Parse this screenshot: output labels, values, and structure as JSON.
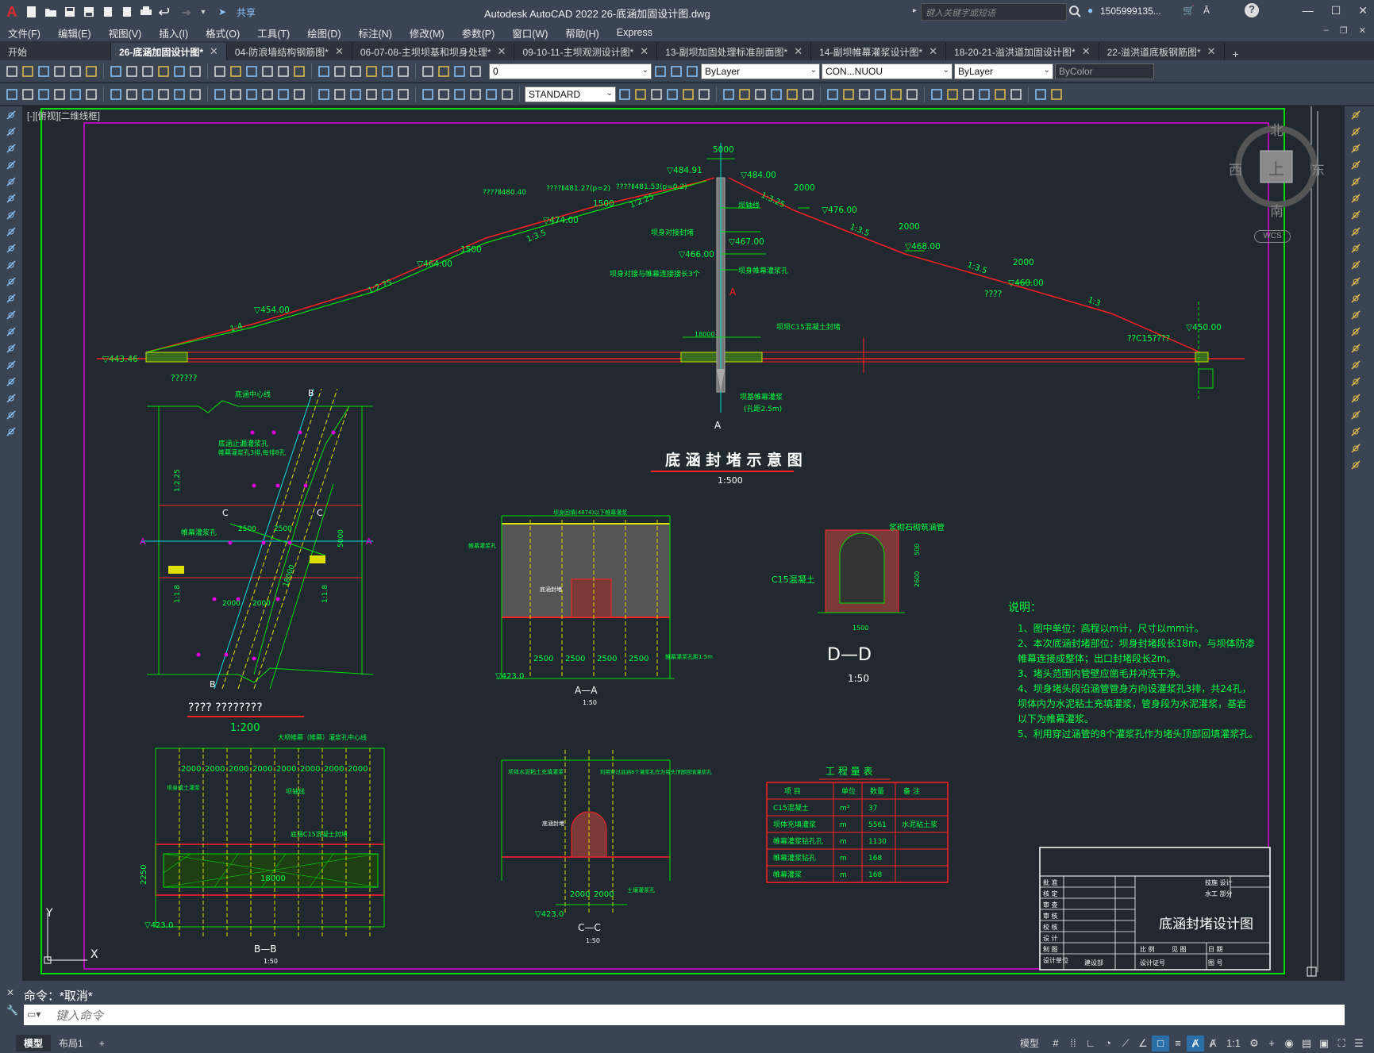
{
  "app": {
    "logo": "A",
    "window_title": "Autodesk AutoCAD 2022    26-底涵加固设计图.dwg",
    "share_label": "共享",
    "search_placeholder": "键入关键字或短语",
    "user_name": "1505999135...",
    "help_label": "?"
  },
  "menus": [
    "文件(F)",
    "编辑(E)",
    "视图(V)",
    "插入(I)",
    "格式(O)",
    "工具(T)",
    "绘图(D)",
    "标注(N)",
    "修改(M)",
    "参数(P)",
    "窗口(W)",
    "帮助(H)",
    "Express"
  ],
  "tabs": [
    {
      "label": "开始",
      "active": false,
      "closable": false
    },
    {
      "label": "26-底涵加固设计图*",
      "active": true,
      "closable": true
    },
    {
      "label": "04-防浪墙结构钢筋图*",
      "active": false,
      "closable": true
    },
    {
      "label": "06-07-08-主坝坝基和坝身处理*",
      "active": false,
      "closable": true
    },
    {
      "label": "09-10-11-主坝观测设计图*",
      "active": false,
      "closable": true
    },
    {
      "label": "13-副坝加固处理标准剖面图*",
      "active": false,
      "closable": true
    },
    {
      "label": "14-副坝帷幕灌浆设计图*",
      "active": false,
      "closable": true
    },
    {
      "label": "18-20-21-溢洪道加固设计图*",
      "active": false,
      "closable": true
    },
    {
      "label": "22-溢洪道底板钢筋图*",
      "active": false,
      "closable": true
    }
  ],
  "toolbar": {
    "layer_value": "0",
    "color_value": "ByLayer",
    "linetype_value": "CON...NUOU",
    "lineweight_value": "ByLayer",
    "plotstyle_value": "ByColor",
    "textstyle_value": "STANDARD"
  },
  "viewport_label": "[-][俯视][二维线框]",
  "viewcube": {
    "north": "北",
    "south": "南",
    "east": "东",
    "west": "西",
    "top": "上",
    "wcs": "WCS"
  },
  "drawing": {
    "main_title": "底 涵 封 堵 示 意 图",
    "main_scale": "1:500",
    "elevations": [
      "▽484.91",
      "▽484.00",
      "▽476.00",
      "▽474.00",
      "▽468.00",
      "▽467.00",
      "▽466.00",
      "▽464.00",
      "▽460.00",
      "▽454.00",
      "▽450.00",
      "▽443.46",
      "▽423.0"
    ],
    "dims_top": [
      "5000",
      "2000",
      "1500",
      "1500",
      "2000",
      "2000",
      "2000",
      "18000",
      "2250"
    ],
    "slopes": [
      "1:2.25",
      "1:2.75",
      "1:3.5",
      "1:4",
      "1:3.25",
      "1:3.5",
      "1:3.5",
      "1:3"
    ],
    "annotations_top": [
      "????Ⅱ480.40",
      "????Ⅱ481.27(p=2)",
      "????Ⅱ481.53(p=0.2)",
      "??????",
      "????",
      "????",
      "??C15????",
      "坝轴线",
      "坝身对接封堵",
      "坝身对接与帷幕连接接长3个",
      "坝身帷幕灌浆孔",
      "坝坝C15混凝土封堵",
      "坝基帷幕灌浆",
      "(孔距2.5m)"
    ],
    "plan_labels": [
      "底涵中心线",
      "底涵止漏灌浆孔",
      "帷幕灌浆孔",
      "帷幕灌浆孔3排,每排8孔"
    ],
    "plan_title": "????    ????????",
    "plan_scale": "1:200",
    "plan_dims": [
      "2500",
      "2500",
      "2000",
      "2000",
      "18000",
      "5000",
      "1:2.25",
      "1:1.8",
      "1:1.8"
    ],
    "section_aa": {
      "title": "A—A",
      "scale": "1:50",
      "dims": [
        "2500",
        "2500",
        "2500",
        "2500"
      ],
      "elev": "▽423.0",
      "labels": [
        "坝身回填(4874)以下帷幕灌浆",
        "帷幕灌浆孔",
        "底涵封堵",
        "帷幕灌浆孔距1.5m"
      ]
    },
    "section_dd": {
      "title": "D—D",
      "scale": "1:50",
      "labels": [
        "C15混凝土",
        "浆砌石砌筑涵管"
      ],
      "dims": [
        "1500",
        "2600",
        "500"
      ]
    },
    "section_bb": {
      "title": "B—B",
      "scale": "1:50",
      "dims": [
        "2000",
        "2000",
        "2000",
        "2000",
        "2000",
        "2000",
        "2000",
        "2000",
        "18000",
        "2250"
      ],
      "labels": [
        "大坝帷幕（帷幕）灌浆孔中心线",
        "底涵C15混凝土封堵",
        "坝身填土灌浆",
        "坝轴线"
      ],
      "elev": "▽423.0"
    },
    "section_cc": {
      "title": "C—C",
      "scale": "1:50",
      "dims": [
        "2000",
        "2000"
      ],
      "elev": "▽423.0",
      "labels": [
        "坝体水泥粘土充填灌浆",
        "利用穿过底涵8个灌浆孔作为堵头顶部回填灌浆孔",
        "底涵封堵",
        "土壤灌浆孔"
      ]
    },
    "notes_title": "说明：",
    "notes": [
      "1、图中单位：高程以m计，尺寸以mm计。",
      "2、本次底涵封堵部位：坝身封堵段长18m，与坝体防渗",
      "   帷幕连接成整体；出口封堵段长2m。",
      "3、堵头范围内管壁应凿毛并冲洗干净。",
      "4、坝身堵头段沿涵管管身方向设灌浆孔3排，共24孔，",
      "   坝体内为水泥粘土充填灌浆，管身段为水泥灌浆，基岩",
      "   以下为帷幕灌浆。",
      "5、利用穿过涵管的8个灌浆孔作为堵头顶部回填灌浆孔。"
    ],
    "qty_table": {
      "title": "工  程  量  表",
      "headers": [
        "项  目",
        "单位",
        "数量",
        "备  注"
      ],
      "rows": [
        [
          "C15混凝土",
          "m³",
          "37",
          ""
        ],
        [
          "坝体充填灌浆",
          "m",
          "5561",
          "水泥粘土浆"
        ],
        [
          "帷幕灌浆钻孔孔",
          "m",
          "1130",
          ""
        ],
        [
          "帷幕灌浆钻孔",
          "m",
          "168",
          ""
        ],
        [
          "帷幕灌浆",
          "m",
          "168",
          ""
        ]
      ]
    },
    "title_block": {
      "title": "底涵封堵设计图",
      "left_rows": [
        "批 准",
        "核 定",
        "审 查",
        "审 核",
        "校 核",
        "设 计",
        "制 图",
        "设计单位"
      ],
      "right_top": [
        "技施  设计",
        "水工  部分"
      ],
      "bottom": [
        "比 例",
        "见 图",
        "日 期",
        "建设部",
        "设计证号",
        "图 号"
      ]
    }
  },
  "command": {
    "history": "命令：*取消*",
    "placeholder": "键入命令"
  },
  "status": {
    "layouts": [
      "模型",
      "布局1"
    ],
    "add": "+",
    "model_label": "模型",
    "scale": "1:1"
  }
}
